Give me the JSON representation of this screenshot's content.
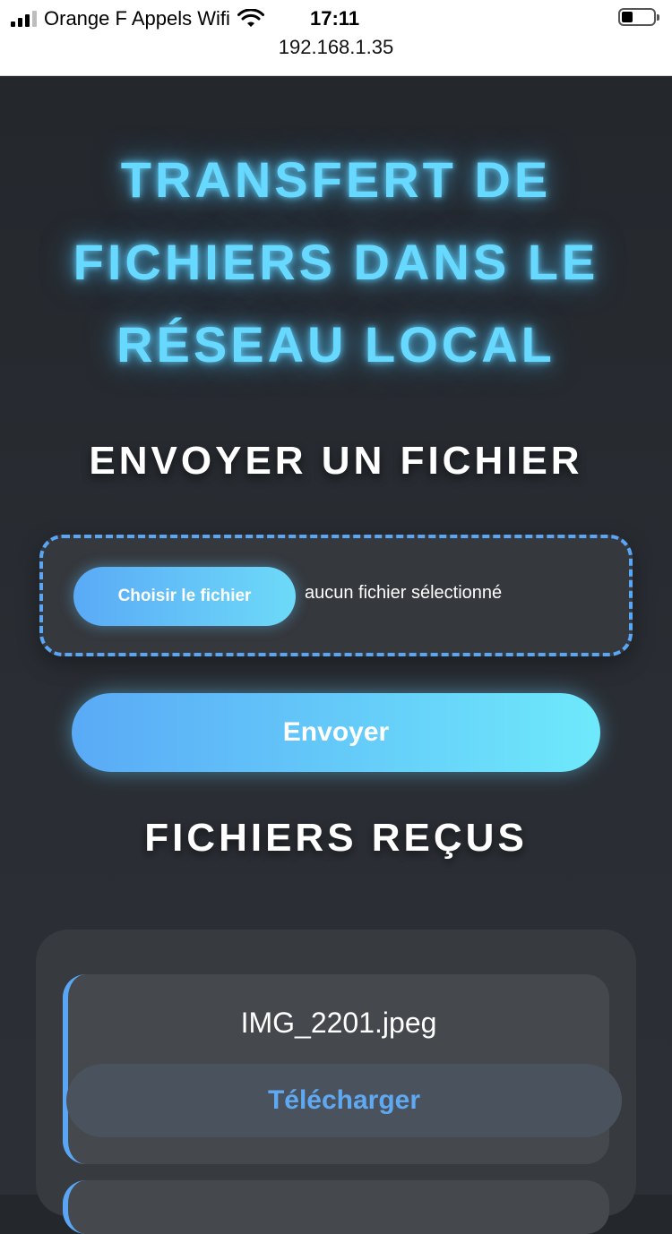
{
  "status_bar": {
    "carrier": "Orange F Appels Wifi",
    "time": "17:11",
    "url": "192.168.1.35",
    "icons": [
      "signal-icon",
      "wifi-icon",
      "battery-icon"
    ]
  },
  "hero": {
    "line1": "TRANSFERT DE",
    "line2": "FICHIERS DANS LE",
    "line3": "RÉSEAU LOCAL"
  },
  "upload": {
    "title": "ENVOYER UN FICHIER",
    "choose_label": "Choisir le fichier",
    "no_file_text": "aucun fichier sélectionné",
    "send_label": "Envoyer"
  },
  "received": {
    "title": "FICHIERS REÇUS",
    "files": [
      {
        "name": "IMG_2201.jpeg",
        "download_label": "Télécharger"
      }
    ]
  },
  "colors": {
    "accent": "#5aa6f5",
    "glow": "#67d8ff",
    "background": "#24272c"
  }
}
